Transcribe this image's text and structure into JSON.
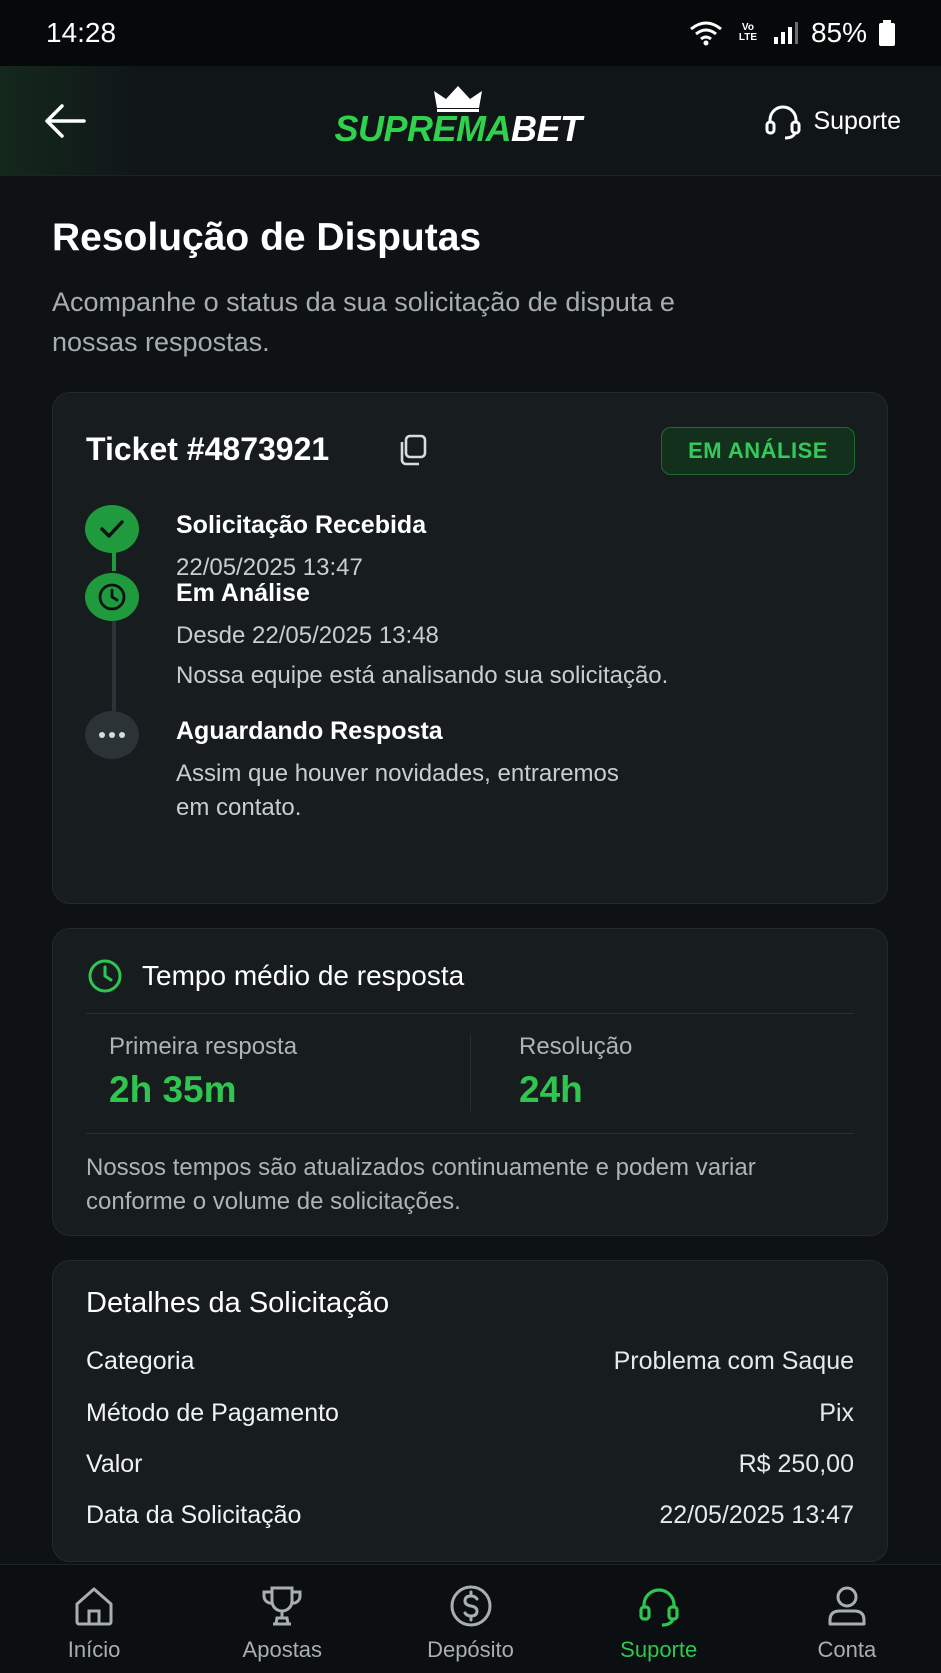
{
  "status_bar": {
    "time": "14:28",
    "network_badge": "Vo LTE",
    "battery": "85%"
  },
  "header": {
    "logo": {
      "part1": "SUPREMA",
      "part2": "BET"
    },
    "support_label": "Suporte"
  },
  "page": {
    "title": "Resolução de Disputas",
    "subtitle": "Acompanhe o status da sua solicitação de disputa e nossas respostas."
  },
  "ticket": {
    "title": "Ticket #4873921",
    "status": "EM ANÁLISE",
    "timeline": [
      {
        "title": "Solicitação Recebida",
        "lines": [
          "22/05/2025 13:47"
        ],
        "state": "done"
      },
      {
        "title": "Em Análise",
        "lines": [
          "Desde 22/05/2025 13:48",
          "Nossa equipe está analisando sua solicitação."
        ],
        "state": "active"
      },
      {
        "title": "Aguardando Resposta",
        "lines": [
          "Assim que houver novidades, entraremos",
          "em contato."
        ],
        "state": "pending"
      }
    ]
  },
  "response_time": {
    "title": "Tempo médio de resposta",
    "first_label": "Primeira resposta",
    "first_value": "2h 35m",
    "resolution_label": "Resolução",
    "resolution_value": "24h",
    "note": "Nossos tempos são atualizados continuamente e podem variar conforme o volume de solicitações."
  },
  "details": {
    "title": "Detalhes da Solicitação",
    "rows": [
      {
        "label": "Categoria",
        "value": "Problema com Saque"
      },
      {
        "label": "Método de Pagamento",
        "value": "Pix"
      },
      {
        "label": "Valor",
        "value": "R$ 250,00"
      },
      {
        "label": "Data da Solicitação",
        "value": "22/05/2025 13:47"
      }
    ]
  },
  "bottom_nav": [
    {
      "label": "Início",
      "icon": "home-icon"
    },
    {
      "label": "Apostas",
      "icon": "trophy-icon"
    },
    {
      "label": "Depósito",
      "icon": "dollar-icon"
    },
    {
      "label": "Suporte",
      "icon": "headset-icon",
      "active": true
    },
    {
      "label": "Conta",
      "icon": "user-icon"
    }
  ],
  "colors": {
    "accent": "#2fc650",
    "background": "#0e1214",
    "card": "#171c1f"
  }
}
